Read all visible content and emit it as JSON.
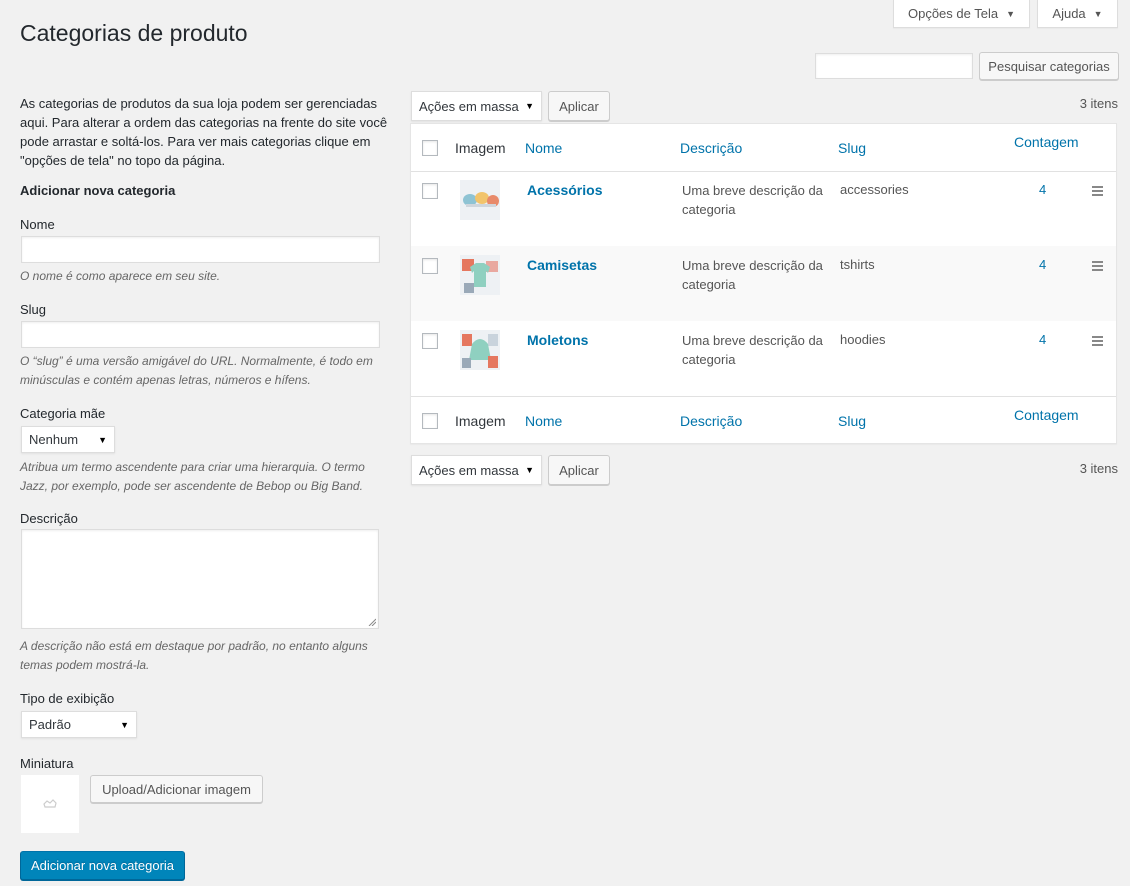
{
  "screen_options": {
    "label": "Opções de Tela"
  },
  "help": {
    "label": "Ajuda"
  },
  "page": {
    "title": "Categorias de produto"
  },
  "search": {
    "button": "Pesquisar categorias",
    "value": ""
  },
  "intro": "As categorias de produtos da sua loja podem ser gerenciadas aqui. Para alterar a ordem das categorias na frente do site você pode arrastar e soltá-los. Para ver mais categorias clique em \"opções de tela\" no topo da página.",
  "form": {
    "title": "Adicionar nova categoria",
    "name_label": "Nome",
    "name_hint": "O nome é como aparece em seu site.",
    "slug_label": "Slug",
    "slug_hint": "O “slug” é uma versão amigável do URL. Normalmente, é todo em minúsculas e contém apenas letras, números e hífens.",
    "parent_label": "Categoria mãe",
    "parent_value": "Nenhum",
    "parent_hint": "Atribua um termo ascendente para criar uma hierarquia. O termo Jazz, por exemplo, pode ser ascendente de Bebop ou Big Band.",
    "description_label": "Descrição",
    "description_hint": "A descrição não está em destaque por padrão, no entanto alguns temas podem mostrá-la.",
    "display_label": "Tipo de exibição",
    "display_value": "Padrão",
    "thumbnail_label": "Miniatura",
    "upload_button": "Upload/Adicionar imagem",
    "submit_button": "Adicionar nova categoria"
  },
  "bulk": {
    "label": "Ações em massa",
    "apply": "Aplicar",
    "count": "3 itens"
  },
  "table": {
    "columns": {
      "image": "Imagem",
      "name": "Nome",
      "description": "Descrição",
      "slug": "Slug",
      "count": "Contagem"
    },
    "rows": [
      {
        "name": "Acessórios",
        "description": "Uma breve descrição da categoria",
        "slug": "accessories",
        "count": "4"
      },
      {
        "name": "Camisetas",
        "description": "Uma breve descrição da categoria",
        "slug": "tshirts",
        "count": "4"
      },
      {
        "name": "Moletons",
        "description": "Uma breve descrição da categoria",
        "slug": "hoodies",
        "count": "4"
      }
    ]
  },
  "colors": {
    "primary": "#0085ba",
    "link": "#0073aa",
    "background": "#f1f1f1"
  }
}
